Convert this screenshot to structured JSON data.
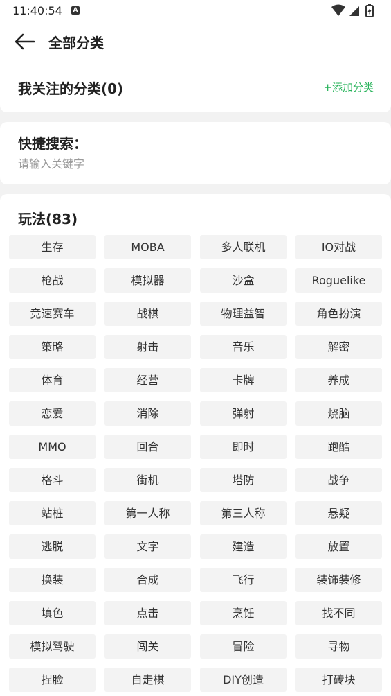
{
  "status_bar": {
    "time": "11:40:54",
    "notification_icon": "A"
  },
  "header": {
    "title": "全部分类"
  },
  "follow": {
    "title": "我关注的分类(0)",
    "add_label": "+添加分类"
  },
  "search": {
    "title": "快捷搜索：",
    "placeholder": "请输入关键字"
  },
  "categories": {
    "title": "玩法(83)",
    "tags": [
      "生存",
      "MOBA",
      "多人联机",
      "IO对战",
      "枪战",
      "模拟器",
      "沙盒",
      "Roguelike",
      "竞速赛车",
      "战棋",
      "物理益智",
      "角色扮演",
      "策略",
      "射击",
      "音乐",
      "解密",
      "体育",
      "经营",
      "卡牌",
      "养成",
      "恋爱",
      "消除",
      "弹射",
      "烧脑",
      "MMO",
      "回合",
      "即时",
      "跑酷",
      "格斗",
      "街机",
      "塔防",
      "战争",
      "站桩",
      "第一人称",
      "第三人称",
      "悬疑",
      "逃脱",
      "文字",
      "建造",
      "放置",
      "换装",
      "合成",
      "飞行",
      "装饰装修",
      "填色",
      "点击",
      "烹饪",
      "找不同",
      "模拟驾驶",
      "闯关",
      "冒险",
      "寻物",
      "捏脸",
      "自走棋",
      "DIY创造",
      "打砖块"
    ]
  },
  "colors": {
    "accent": "#27b35a",
    "tag_bg": "#f3f3f3",
    "page_bg": "#f2f2f2"
  }
}
